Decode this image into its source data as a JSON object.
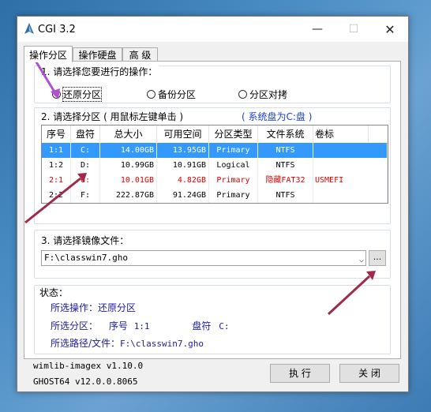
{
  "window": {
    "title": "CGI 3.2"
  },
  "tabs": [
    "操作分区",
    "操作硬盘",
    "高 级"
  ],
  "step1": {
    "label": "1. 请选择您要进行的操作：",
    "options": [
      "还原分区",
      "备份分区",
      "分区对拷"
    ],
    "selected": "还原分区"
  },
  "step2": {
    "label": "2. 请选择分区 ( 用鼠标左键单击 )",
    "system_note": "( 系统盘为C:盘 )",
    "columns": [
      "序号",
      "盘符",
      "总大小",
      "可用空间",
      "分区类型",
      "文件系统",
      "卷标"
    ],
    "rows": [
      {
        "id": "1:1",
        "drive": "C:",
        "total": "14.00GB",
        "free": "13.95GB",
        "type": "Primary",
        "fs": "NTFS",
        "label": "",
        "selected": true
      },
      {
        "id": "1:2",
        "drive": "D:",
        "total": "10.99GB",
        "free": "10.91GB",
        "type": "Logical",
        "fs": "NTFS",
        "label": ""
      },
      {
        "id": "2:1",
        "drive": "G:",
        "total": "10.01GB",
        "free": "4.82GB",
        "type": "Primary",
        "fs": "隐藏FAT32",
        "label": "USMEFI",
        "highlight": "red"
      },
      {
        "id": "2:2",
        "drive": "F:",
        "total": "222.87GB",
        "free": "91.24GB",
        "type": "Primary",
        "fs": "NTFS",
        "label": ""
      }
    ]
  },
  "step3": {
    "label": "3. 请选择镜像文件：",
    "path": "F:\\classwin7.gho",
    "browse_label": "..."
  },
  "status": {
    "title": "状态：",
    "operation_label": "所选操作：",
    "operation_value": "还原分区",
    "partition_label": "所选分区：",
    "partition_no_label": "序号",
    "partition_no": "1:1",
    "drive_label": "盘符",
    "drive_value": "C:",
    "path_label": "所选路径/文件：",
    "path_value": "F:\\classwin7.gho"
  },
  "footer": {
    "wimlib": "wimlib-imagex v1.10.0",
    "ghost": "GHOST64 v12.0.0.8065",
    "execute_label": "执 行",
    "close_label": "关 闭"
  },
  "colors": {
    "selection": "#3399ff",
    "status_text": "#1a1aa6",
    "arrow": "#a02a4a",
    "purple_arrow": "#b04fd0"
  }
}
